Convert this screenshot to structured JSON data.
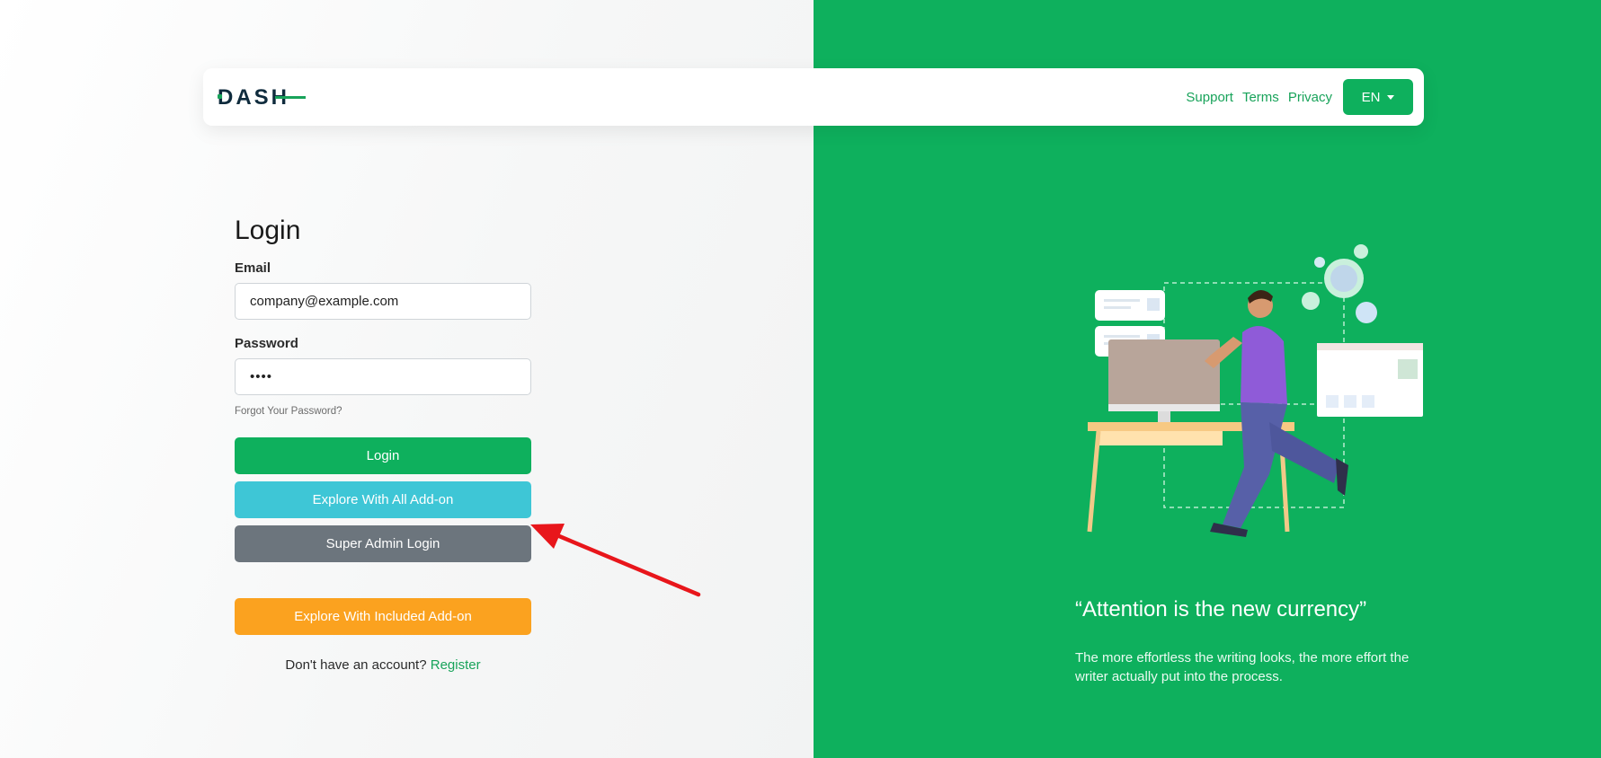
{
  "brand": {
    "logo_text": "DASH"
  },
  "nav": {
    "links": [
      "Support",
      "Terms",
      "Privacy"
    ],
    "language": "EN"
  },
  "login": {
    "title": "Login",
    "email_label": "Email",
    "email_value": "company@example.com",
    "password_label": "Password",
    "password_value": "1234",
    "forgot_link": "Forgot Your Password?",
    "login_button": "Login",
    "explore_all_button": "Explore With All Add-on",
    "super_admin_button": "Super Admin Login",
    "explore_included_button": "Explore With Included Add-on",
    "no_account_text": "Don't have an account?",
    "register_link": "Register"
  },
  "hero": {
    "quote": "“Attention is the new currency”",
    "subtext": "The more effortless the writing looks, the more effort the writer actually put into the process."
  },
  "colors": {
    "primary": "#0eb05d",
    "info": "#3ec6d6",
    "secondary": "#6c757d",
    "warning": "#fba21f",
    "annotation_arrow": "#e8161b"
  },
  "icons": {
    "language_caret": "caret-down-icon",
    "annotation": "red-arrow-icon"
  }
}
